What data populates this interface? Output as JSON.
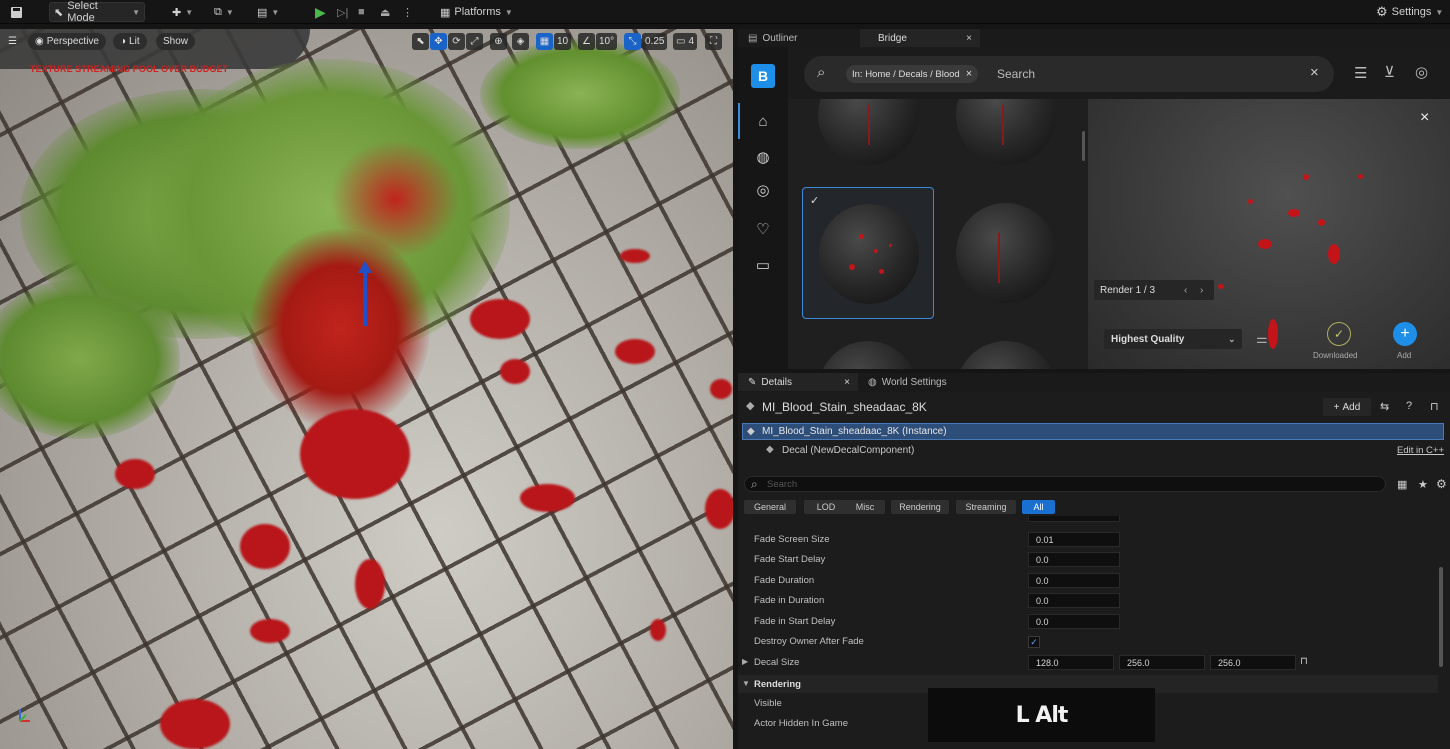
{
  "toolbar": {
    "select_mode": "Select Mode",
    "platforms": "Platforms",
    "settings": "Settings"
  },
  "viewport": {
    "perspective": "Perspective",
    "lit": "Lit",
    "show": "Show",
    "grid_snap": "10",
    "rotation_snap": "10°",
    "scale_snap": "0.25",
    "camera_speed": "4",
    "warning": "TEXTURE STREAMING POOL OVER BUDGET"
  },
  "panel_tabs": {
    "outliner": "Outliner",
    "bridge": "Bridge"
  },
  "bridge": {
    "search_chip": "In: Home / Decals / Blood",
    "search_placeholder": "Search",
    "render_counter": "Render 1 / 3",
    "quality": "Highest Quality",
    "downloaded": "Downloaded",
    "add": "Add"
  },
  "details": {
    "tab_details": "Details",
    "tab_world_settings": "World Settings",
    "object_name": "MI_Blood_Stain_sheadaac_8K",
    "add_label": "Add",
    "instance": "MI_Blood_Stain_sheadaac_8K (Instance)",
    "component": "Decal (NewDecalComponent)",
    "edit_cpp": "Edit in C++",
    "search_placeholder": "Search",
    "filters": [
      "General",
      "LOD",
      "Misc",
      "Rendering",
      "Streaming",
      "All"
    ],
    "properties": [
      {
        "label": "Fade Screen Size",
        "value": "0.01"
      },
      {
        "label": "Fade Start Delay",
        "value": "0.0"
      },
      {
        "label": "Fade Duration",
        "value": "0.0"
      },
      {
        "label": "Fade in Duration",
        "value": "0.0"
      },
      {
        "label": "Fade in Start Delay",
        "value": "0.0"
      },
      {
        "label": "Destroy Owner After Fade",
        "value": ""
      }
    ],
    "decal_size": {
      "label": "Decal Size",
      "x": "128.0",
      "y": "256.0",
      "z": "256.0"
    },
    "rendering_section": "Rendering",
    "visible": "Visible",
    "actor_hidden": "Actor Hidden In Game"
  },
  "overlay_key": "L Alt"
}
